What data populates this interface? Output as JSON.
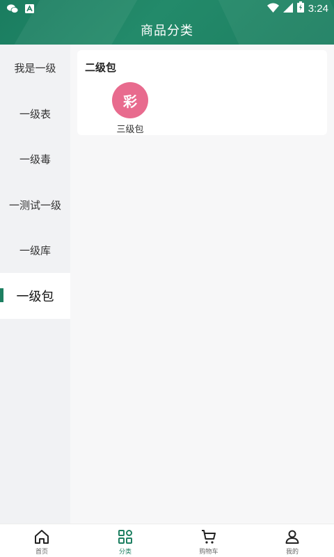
{
  "status_bar": {
    "time": "3:24"
  },
  "header": {
    "title": "商品分类"
  },
  "sidebar": {
    "items": [
      {
        "label": "我是一级",
        "active": false
      },
      {
        "label": "一级表",
        "active": false
      },
      {
        "label": "一级毒",
        "active": false
      },
      {
        "label": "一测试一级",
        "active": false
      },
      {
        "label": "一级库",
        "active": false
      },
      {
        "label": "一级包",
        "active": true
      }
    ]
  },
  "content": {
    "section_title": "二级包",
    "subcategories": [
      {
        "label": "三级包",
        "thumb_text": "彩",
        "thumb_color": "#e86b8e"
      }
    ]
  },
  "tabbar": {
    "tabs": [
      {
        "label": "首页",
        "icon": "home-icon",
        "active": false
      },
      {
        "label": "分类",
        "icon": "category-icon",
        "active": true
      },
      {
        "label": "购物车",
        "icon": "cart-icon",
        "active": false
      },
      {
        "label": "我的",
        "icon": "user-icon",
        "active": false
      }
    ]
  },
  "colors": {
    "brand": "#1d7f61",
    "sidebar_bg": "#f1f2f4",
    "thumb": "#e86b8e"
  }
}
